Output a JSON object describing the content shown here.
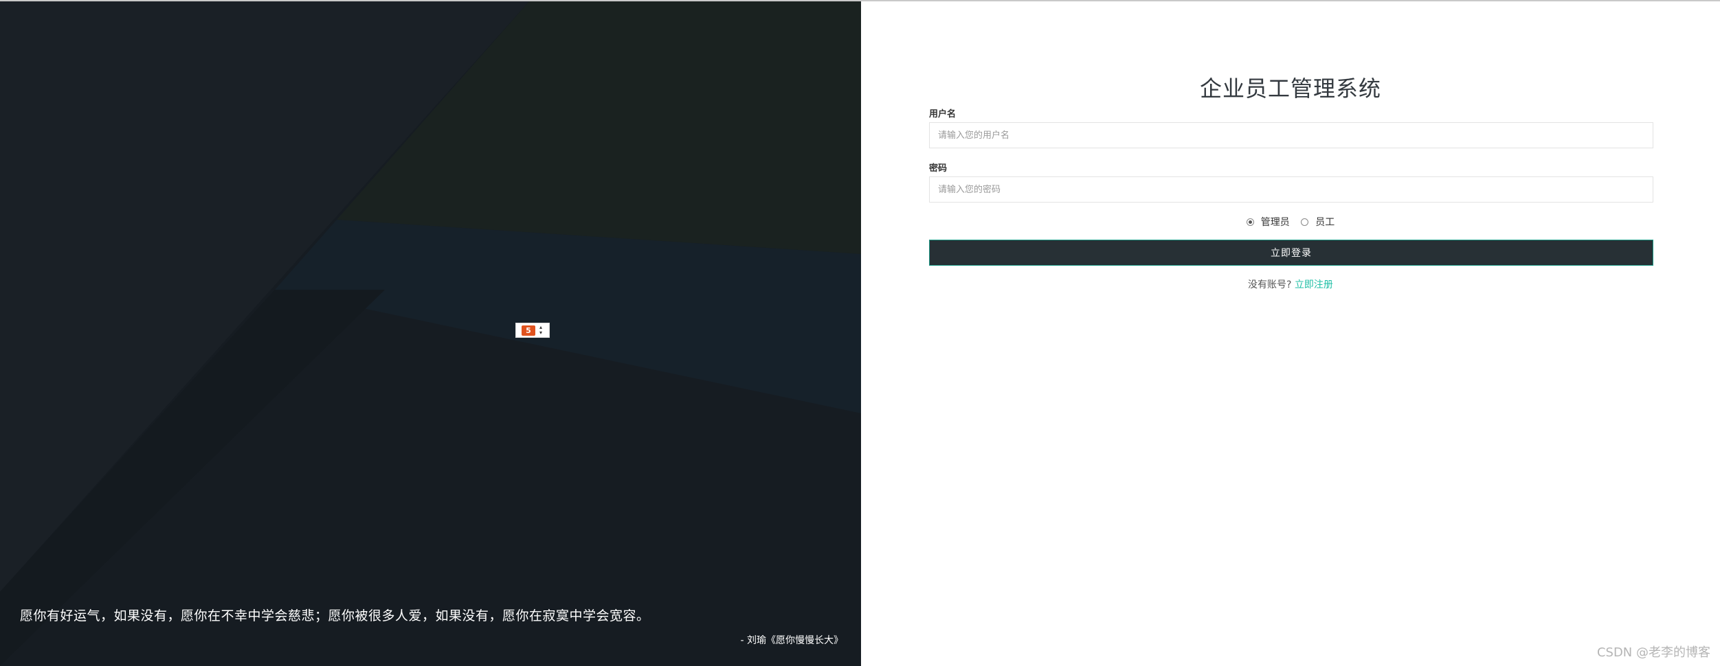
{
  "colors": {
    "left_bg": "#161c22",
    "accent": "#1fbfa5",
    "button_bg": "#273035",
    "title_color": "#33393f"
  },
  "left": {
    "quote": "愿你有好运气，如果没有，愿你在不幸中学会慈悲；愿你被很多人爱，如果没有，愿你在寂寞中学会宽容。",
    "quote_author": "- 刘瑜《愿你慢慢长大》",
    "broken_image_icon": "broken-image-icon"
  },
  "login": {
    "title": "企业员工管理系统",
    "username_label": "用户名",
    "username_placeholder": "请输入您的用户名",
    "username_value": "",
    "password_label": "密码",
    "password_placeholder": "请输入您的密码",
    "password_value": "",
    "roles": [
      {
        "label": "管理员",
        "checked": true
      },
      {
        "label": "员工",
        "checked": false
      }
    ],
    "login_button": "立即登录",
    "no_account_text": "没有账号?",
    "register_link": "立即注册"
  },
  "watermark": "CSDN @老李的博客"
}
